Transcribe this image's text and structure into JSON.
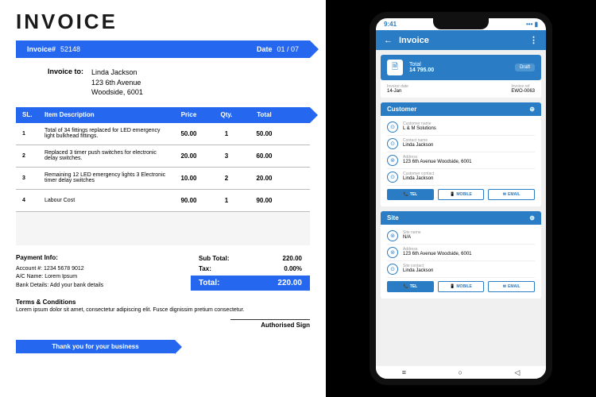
{
  "invoice": {
    "title": "INVOICE",
    "number_label": "Invoice#",
    "number": "52148",
    "date_label": "Date",
    "date": "01 / 07",
    "to_label": "Invoice to:",
    "recipient": {
      "name": "Linda Jackson",
      "line1": "123 6th Avenue",
      "line2": "Woodside, 6001"
    },
    "columns": {
      "sl": "SL.",
      "desc": "Item Description",
      "price": "Price",
      "qty": "Qty.",
      "total": "Total"
    },
    "rows": [
      {
        "sl": "1",
        "desc": "Total of 34 fittings replaced for LED emergency light bulkhead fittings.",
        "price": "50.00",
        "qty": "1",
        "total": "50.00"
      },
      {
        "sl": "2",
        "desc": "Replaced 3 timer push switches for electronic delay switches.",
        "price": "20.00",
        "qty": "3",
        "total": "60.00"
      },
      {
        "sl": "3",
        "desc": "Remaining 12 LED emergency lights 3 Electronic timer delay switches",
        "price": "10.00",
        "qty": "2",
        "total": "20.00"
      },
      {
        "sl": "4",
        "desc": "Labour Cost",
        "price": "90.00",
        "qty": "1",
        "total": "90.00"
      }
    ],
    "subtotal_label": "Sub Total:",
    "subtotal": "220.00",
    "tax_label": "Tax:",
    "tax": "0.00%",
    "total_label": "Total:",
    "total": "220.00",
    "payment": {
      "hdr": "Payment Info:",
      "acct_lbl": "Account #:",
      "acct": "1234 5678 9012",
      "name_lbl": "A/C Name:",
      "name": "Lorem Ipsum",
      "bank_lbl": "Bank Details:",
      "bank": "Add your bank details"
    },
    "terms": {
      "hdr": "Terms & Conditions",
      "body": "Lorem ipsum dolor sit amet, consectetur adipiscing elit. Fusce dignissim pretium consectetur."
    },
    "sign": "Authorised Sign",
    "footer": "Thank you for your business"
  },
  "phone": {
    "time": "9:41",
    "title": "Invoice",
    "total_label": "Total",
    "total_value": "14 795.00",
    "draft": "Draft",
    "date_lbl": "Invoice date",
    "date_val": "14-Jan",
    "ref_lbl": "Invoice ref",
    "ref_val": "EWO-0063",
    "customer": {
      "hdr": "Customer",
      "name_lbl": "Customer name",
      "name": "L & M Solutions",
      "contact_lbl": "Contact name",
      "contact": "Linda Jackson",
      "addr_lbl": "Address",
      "addr": "123 6th Avenue Woodside, 6001",
      "cust_contact_lbl": "Customer contact",
      "cust_contact": "Linda Jackson"
    },
    "site": {
      "hdr": "Site",
      "name_lbl": "Site name",
      "name": "N/A",
      "addr_lbl": "Address",
      "addr": "123 6th Avenue Woodside, 6001",
      "contact_lbl": "Site contact",
      "contact": "Linda Jackson"
    },
    "btns": {
      "tel": "TEL",
      "mobile": "MOBILE",
      "email": "EMAIL"
    }
  }
}
